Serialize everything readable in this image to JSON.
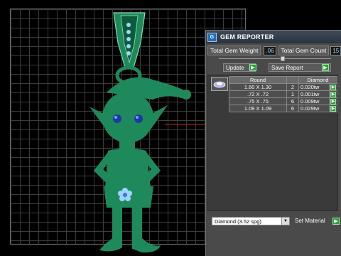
{
  "panel": {
    "logo_text": "G",
    "title": "GEM REPORTER",
    "total_weight_label": "Total Gem Weight",
    "total_weight_value": ".06",
    "total_count_label": "Total Gem Count",
    "total_count_value": "15",
    "update_label": "Update",
    "save_label": "Save Report",
    "table": {
      "headers": [
        "Round",
        "",
        "Diamond"
      ],
      "rows": [
        {
          "size": "1.60 X 1.30",
          "count": "2",
          "weight": "0.020tw"
        },
        {
          "size": ".72 X .72",
          "count": "1",
          "weight": "0.001tw"
        },
        {
          "size": ".75 X .75",
          "count": "6",
          "weight": "0.009tw"
        },
        {
          "size": "1.09 X 1.09",
          "count": "6",
          "weight": "0.029tw"
        }
      ]
    },
    "material_select": "Diamond    (3.52 spg)",
    "set_material_label": "Set Material"
  },
  "colors": {
    "elf": "#1e8a5c",
    "accent": "#2aa03a",
    "title_bg": "#2a3340"
  }
}
